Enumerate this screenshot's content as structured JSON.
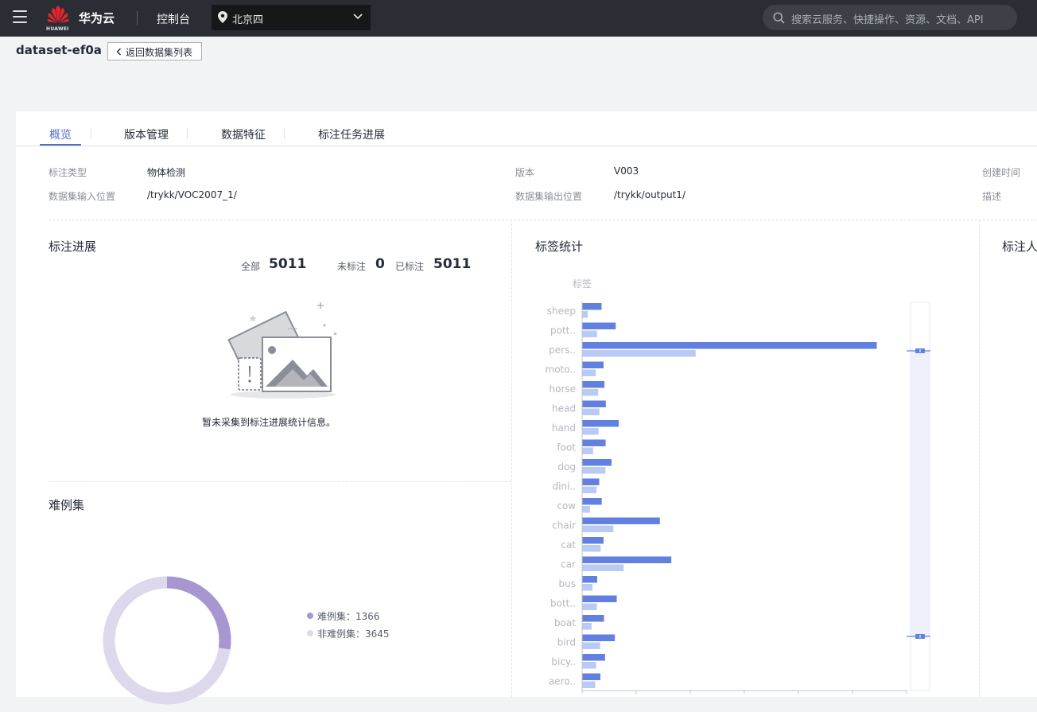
{
  "topbar": {
    "logo_text": "HUAWEI",
    "brand": "华为云",
    "console": "控制台",
    "region": "北京四",
    "search_placeholder": "搜索云服务、快捷操作、资源、文档、API"
  },
  "header": {
    "dataset_name": "dataset-ef0a",
    "back_label": "返回数据集列表"
  },
  "tabs": [
    {
      "label": "概览",
      "active": true
    },
    {
      "label": "版本管理",
      "active": false
    },
    {
      "label": "数据特征",
      "active": false
    },
    {
      "label": "标注任务进展",
      "active": false
    }
  ],
  "info": {
    "label_type_label": "标注类型",
    "label_type_value": "物体检测",
    "version_label": "版本",
    "version_value": "V003",
    "created_label": "创建时间",
    "input_label": "数据集输入位置",
    "input_value": "/trykk/VOC2007_1/",
    "output_label": "数据集输出位置",
    "output_value": "/trykk/output1/",
    "desc_label": "描述"
  },
  "progress": {
    "title": "标注进展",
    "total_label": "全部",
    "total_value": "5011",
    "unlabeled_label": "未标注",
    "unlabeled_value": "0",
    "labeled_label": "已标注",
    "labeled_value": "5011",
    "empty_message": "暂未采集到标注进展统计信息。"
  },
  "hard_examples": {
    "title": "难例集",
    "hard_legend": "难例集：1366",
    "nonhard_legend": "非难例集：3645",
    "hard_value": 1366,
    "nonhard_value": 3645,
    "hard_color": "#a896d0",
    "nonhard_color": "#ddd8ec"
  },
  "label_stats": {
    "title": "标签统计",
    "annotator_title": "标注人"
  },
  "chart_data": {
    "type": "bar",
    "orientation": "horizontal",
    "ylabel": "标签",
    "categories": [
      "sheep",
      "pott..",
      "pers..",
      "moto..",
      "horse",
      "head",
      "hand",
      "foot",
      "dog",
      "dini..",
      "cow",
      "chair",
      "cat",
      "car",
      "bus",
      "bott..",
      "boat",
      "bird",
      "bicy..",
      "aero.."
    ],
    "series": [
      {
        "values": [
          353,
          615,
          5447,
          390,
          406,
          432,
          671,
          428,
          538,
          309,
          356,
          1432,
          389,
          1644,
          272,
          634,
          398,
          599,
          418,
          331
        ],
        "color": "#6280e0"
      },
      {
        "values": [
          98,
          269,
          2095,
          246,
          290,
          312,
          297,
          196,
          425,
          259,
          139,
          572,
          337,
          761,
          186,
          267,
          168,
          326,
          253,
          236
        ],
        "color": "#b9cbf5"
      }
    ],
    "grid": false,
    "legend": "none"
  }
}
